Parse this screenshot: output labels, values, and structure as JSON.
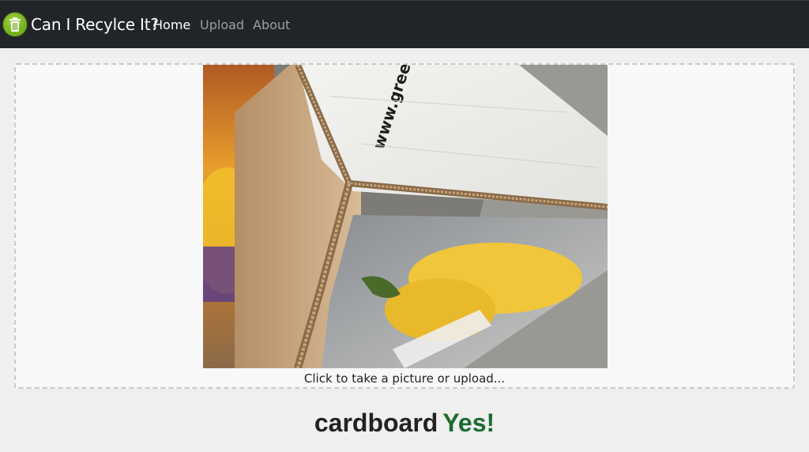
{
  "navbar": {
    "brand": "Can I Recylce It?",
    "items": [
      {
        "label": "Home",
        "active": true
      },
      {
        "label": "Upload",
        "active": false
      },
      {
        "label": "About",
        "active": false
      }
    ],
    "logo_icon": "trash-can-icon",
    "background": "#212529"
  },
  "upload": {
    "caption": "Click to take a picture or upload...",
    "image_icon": "cardboard-box-photo"
  },
  "result": {
    "material": "cardboard",
    "verdict": "Yes!",
    "verdict_color": "#1b6b2f"
  },
  "photo_text": "www.green"
}
